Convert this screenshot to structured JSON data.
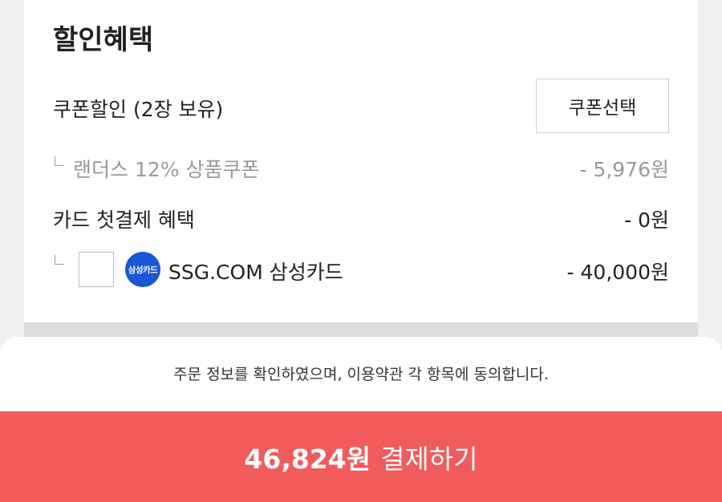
{
  "discount_section": {
    "title": "할인혜택",
    "coupon": {
      "label": "쿠폰할인 (2장 보유)",
      "button_label": "쿠폰선택",
      "applied_name": "랜더스 12% 상품쿠폰",
      "applied_amount": "- 5,976원"
    },
    "card_first_payment": {
      "label": "카드 첫결제 혜택",
      "amount": "- 0원",
      "option": {
        "logo_text": "삼성카드",
        "name": "SSG.COM 삼성카드",
        "amount": "- 40,000원",
        "checked": false
      }
    }
  },
  "footer": {
    "agreement_text": "주문 정보를 확인하였으며, 이용약관 각 항목에 동의합니다.",
    "pay_amount": "46,824원",
    "pay_label": "결제하기",
    "pay_color": "#f15b5b"
  },
  "colors": {
    "card_logo": "#1a57d6",
    "muted_text": "#999999"
  }
}
